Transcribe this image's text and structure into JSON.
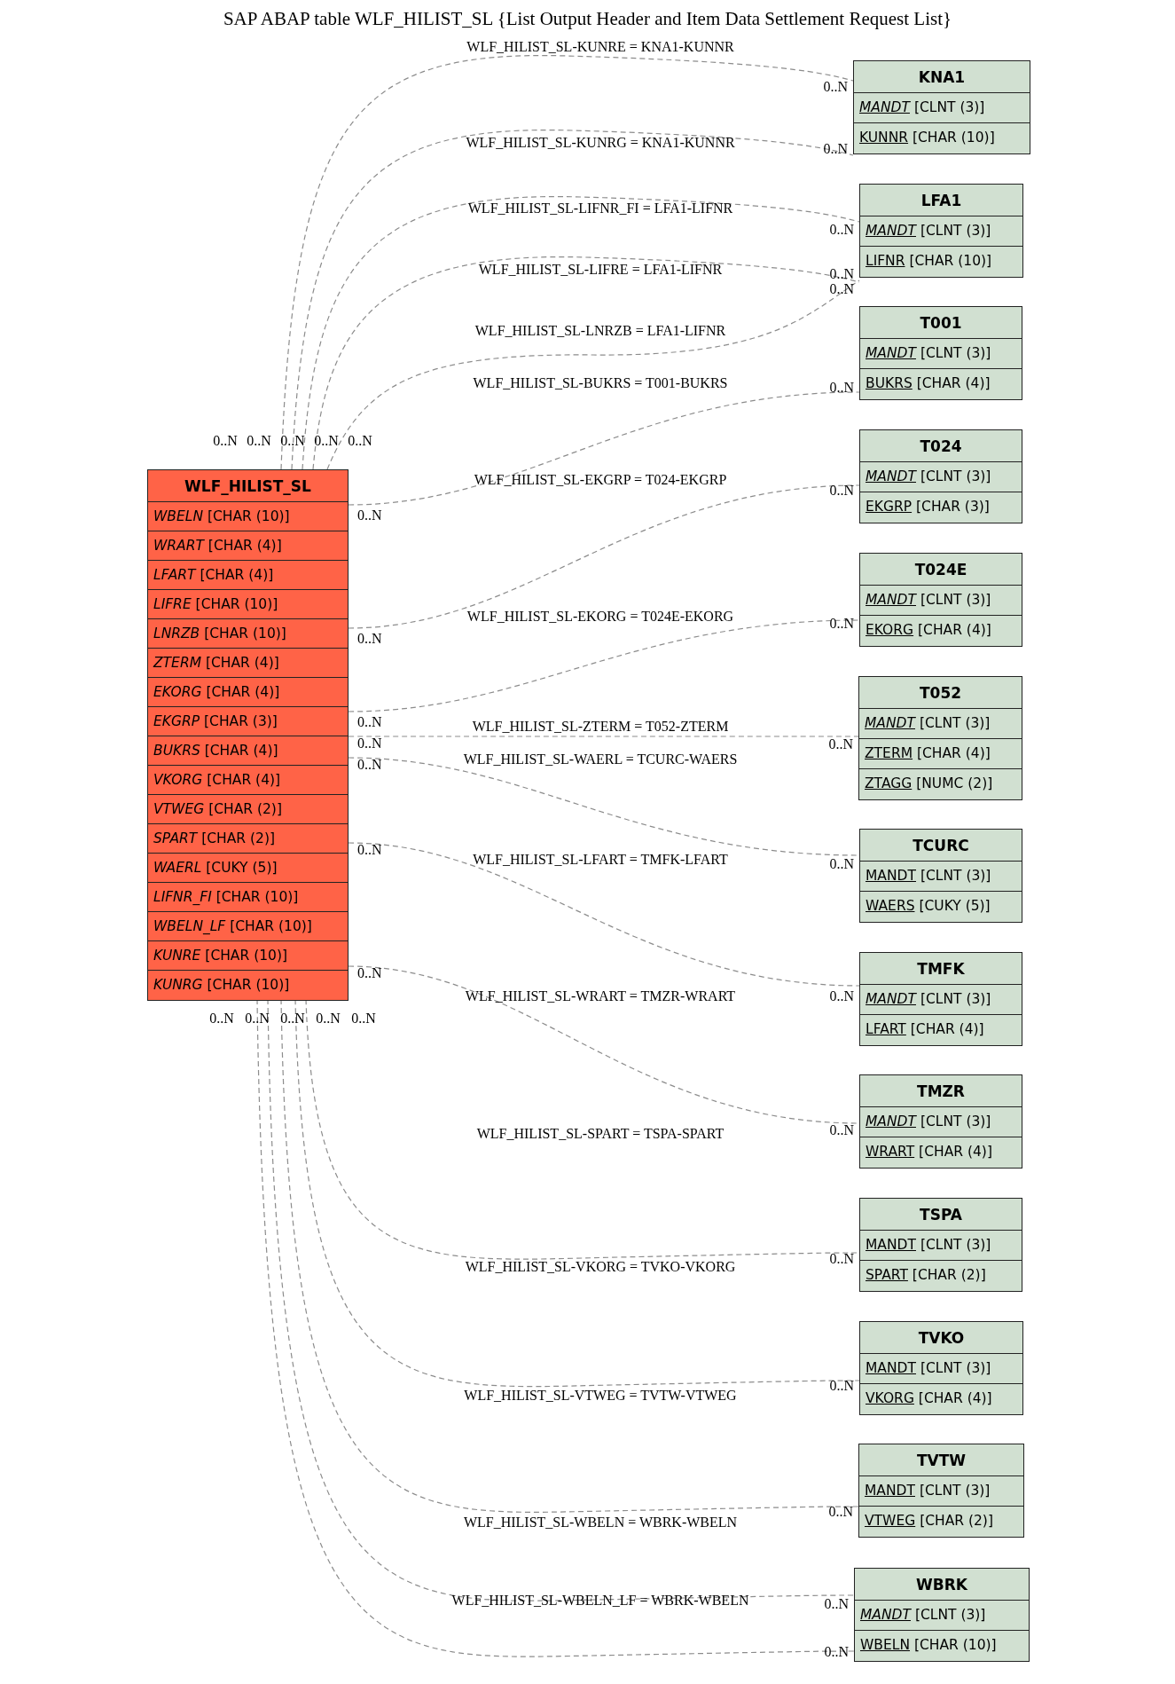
{
  "title": "SAP ABAP table WLF_HILIST_SL {List Output Header and Item Data Settlement Request List}",
  "main_table": {
    "name": "WLF_HILIST_SL",
    "fields": [
      {
        "name": "WBELN",
        "type": "[CHAR (10)]",
        "italic": true,
        "key": false
      },
      {
        "name": "WRART",
        "type": "[CHAR (4)]",
        "italic": true,
        "key": false
      },
      {
        "name": "LFART",
        "type": "[CHAR (4)]",
        "italic": true,
        "key": false
      },
      {
        "name": "LIFRE",
        "type": "[CHAR (10)]",
        "italic": true,
        "key": false
      },
      {
        "name": "LNRZB",
        "type": "[CHAR (10)]",
        "italic": true,
        "key": false
      },
      {
        "name": "ZTERM",
        "type": "[CHAR (4)]",
        "italic": true,
        "key": false
      },
      {
        "name": "EKORG",
        "type": "[CHAR (4)]",
        "italic": true,
        "key": false
      },
      {
        "name": "EKGRP",
        "type": "[CHAR (3)]",
        "italic": true,
        "key": false
      },
      {
        "name": "BUKRS",
        "type": "[CHAR (4)]",
        "italic": true,
        "key": false
      },
      {
        "name": "VKORG",
        "type": "[CHAR (4)]",
        "italic": true,
        "key": false
      },
      {
        "name": "VTWEG",
        "type": "[CHAR (2)]",
        "italic": true,
        "key": false
      },
      {
        "name": "SPART",
        "type": "[CHAR (2)]",
        "italic": true,
        "key": false
      },
      {
        "name": "WAERL",
        "type": "[CUKY (5)]",
        "italic": true,
        "key": false
      },
      {
        "name": "LIFNR_FI",
        "type": "[CHAR (10)]",
        "italic": true,
        "key": false
      },
      {
        "name": "WBELN_LF",
        "type": "[CHAR (10)]",
        "italic": true,
        "key": false
      },
      {
        "name": "KUNRE",
        "type": "[CHAR (10)]",
        "italic": true,
        "key": false
      },
      {
        "name": "KUNRG",
        "type": "[CHAR (10)]",
        "italic": true,
        "key": false
      }
    ]
  },
  "related_tables": [
    {
      "name": "KNA1",
      "fields": [
        {
          "name": "MANDT",
          "type": "[CLNT (3)]",
          "italic": true,
          "key": true
        },
        {
          "name": "KUNNR",
          "type": "[CHAR (10)]",
          "italic": false,
          "key": true
        }
      ]
    },
    {
      "name": "LFA1",
      "fields": [
        {
          "name": "MANDT",
          "type": "[CLNT (3)]",
          "italic": true,
          "key": true
        },
        {
          "name": "LIFNR",
          "type": "[CHAR (10)]",
          "italic": false,
          "key": true
        }
      ]
    },
    {
      "name": "T001",
      "fields": [
        {
          "name": "MANDT",
          "type": "[CLNT (3)]",
          "italic": true,
          "key": true
        },
        {
          "name": "BUKRS",
          "type": "[CHAR (4)]",
          "italic": false,
          "key": true
        }
      ]
    },
    {
      "name": "T024",
      "fields": [
        {
          "name": "MANDT",
          "type": "[CLNT (3)]",
          "italic": true,
          "key": true
        },
        {
          "name": "EKGRP",
          "type": "[CHAR (3)]",
          "italic": false,
          "key": true
        }
      ]
    },
    {
      "name": "T024E",
      "fields": [
        {
          "name": "MANDT",
          "type": "[CLNT (3)]",
          "italic": true,
          "key": true
        },
        {
          "name": "EKORG",
          "type": "[CHAR (4)]",
          "italic": false,
          "key": true
        }
      ]
    },
    {
      "name": "T052",
      "fields": [
        {
          "name": "MANDT",
          "type": "[CLNT (3)]",
          "italic": true,
          "key": true
        },
        {
          "name": "ZTERM",
          "type": "[CHAR (4)]",
          "italic": false,
          "key": true
        },
        {
          "name": "ZTAGG",
          "type": "[NUMC (2)]",
          "italic": false,
          "key": true
        }
      ]
    },
    {
      "name": "TCURC",
      "fields": [
        {
          "name": "MANDT",
          "type": "[CLNT (3)]",
          "italic": false,
          "key": true
        },
        {
          "name": "WAERS",
          "type": "[CUKY (5)]",
          "italic": false,
          "key": true
        }
      ]
    },
    {
      "name": "TMFK",
      "fields": [
        {
          "name": "MANDT",
          "type": "[CLNT (3)]",
          "italic": true,
          "key": true
        },
        {
          "name": "LFART",
          "type": "[CHAR (4)]",
          "italic": false,
          "key": true
        }
      ]
    },
    {
      "name": "TMZR",
      "fields": [
        {
          "name": "MANDT",
          "type": "[CLNT (3)]",
          "italic": true,
          "key": true
        },
        {
          "name": "WRART",
          "type": "[CHAR (4)]",
          "italic": false,
          "key": true
        }
      ]
    },
    {
      "name": "TSPA",
      "fields": [
        {
          "name": "MANDT",
          "type": "[CLNT (3)]",
          "italic": false,
          "key": true
        },
        {
          "name": "SPART",
          "type": "[CHAR (2)]",
          "italic": false,
          "key": true
        }
      ]
    },
    {
      "name": "TVKO",
      "fields": [
        {
          "name": "MANDT",
          "type": "[CLNT (3)]",
          "italic": false,
          "key": true
        },
        {
          "name": "VKORG",
          "type": "[CHAR (4)]",
          "italic": false,
          "key": true
        }
      ]
    },
    {
      "name": "TVTW",
      "fields": [
        {
          "name": "MANDT",
          "type": "[CLNT (3)]",
          "italic": false,
          "key": true
        },
        {
          "name": "VTWEG",
          "type": "[CHAR (2)]",
          "italic": false,
          "key": true
        }
      ]
    },
    {
      "name": "WBRK",
      "fields": [
        {
          "name": "MANDT",
          "type": "[CLNT (3)]",
          "italic": true,
          "key": true
        },
        {
          "name": "WBELN",
          "type": "[CHAR (10)]",
          "italic": false,
          "key": true
        }
      ]
    }
  ],
  "relations": [
    {
      "label": "WLF_HILIST_SL-KUNRE = KNA1-KUNNR",
      "source_card": "0..N",
      "target_card": "0..N"
    },
    {
      "label": "WLF_HILIST_SL-KUNRG = KNA1-KUNNR",
      "source_card": "0..N",
      "target_card": "0..N"
    },
    {
      "label": "WLF_HILIST_SL-LIFNR_FI = LFA1-LIFNR",
      "source_card": "0..N",
      "target_card": "0..N"
    },
    {
      "label": "WLF_HILIST_SL-LIFRE = LFA1-LIFNR",
      "source_card": "0..N",
      "target_card": "0..N"
    },
    {
      "label": "WLF_HILIST_SL-LNRZB = LFA1-LIFNR",
      "source_card": "0..N",
      "target_card": "0..N"
    },
    {
      "label": "WLF_HILIST_SL-BUKRS = T001-BUKRS",
      "source_card": "0..N",
      "target_card": "0..N"
    },
    {
      "label": "WLF_HILIST_SL-EKGRP = T024-EKGRP",
      "source_card": "0..N",
      "target_card": "0..N"
    },
    {
      "label": "WLF_HILIST_SL-EKORG = T024E-EKORG",
      "source_card": "0..N",
      "target_card": "0..N"
    },
    {
      "label": "WLF_HILIST_SL-ZTERM = T052-ZTERM",
      "source_card": "0..N",
      "target_card": "0..N"
    },
    {
      "label": "WLF_HILIST_SL-WAERL = TCURC-WAERS",
      "source_card": "0..N",
      "target_card": "0..N"
    },
    {
      "label": "WLF_HILIST_SL-LFART = TMFK-LFART",
      "source_card": "0..N",
      "target_card": "0..N"
    },
    {
      "label": "WLF_HILIST_SL-WRART = TMZR-WRART",
      "source_card": "0..N",
      "target_card": "0..N"
    },
    {
      "label": "WLF_HILIST_SL-SPART = TSPA-SPART",
      "source_card": "0..N",
      "target_card": "0..N"
    },
    {
      "label": "WLF_HILIST_SL-VKORG = TVKO-VKORG",
      "source_card": "0..N",
      "target_card": "0..N"
    },
    {
      "label": "WLF_HILIST_SL-VTWEG = TVTW-VTWEG",
      "source_card": "0..N",
      "target_card": "0..N"
    },
    {
      "label": "WLF_HILIST_SL-WBELN = WBRK-WBELN",
      "source_card": "0..N",
      "target_card": "0..N"
    },
    {
      "label": "WLF_HILIST_SL-WBELN_LF = WBRK-WBELN",
      "source_card": "0..N",
      "target_card": "0..N"
    }
  ]
}
